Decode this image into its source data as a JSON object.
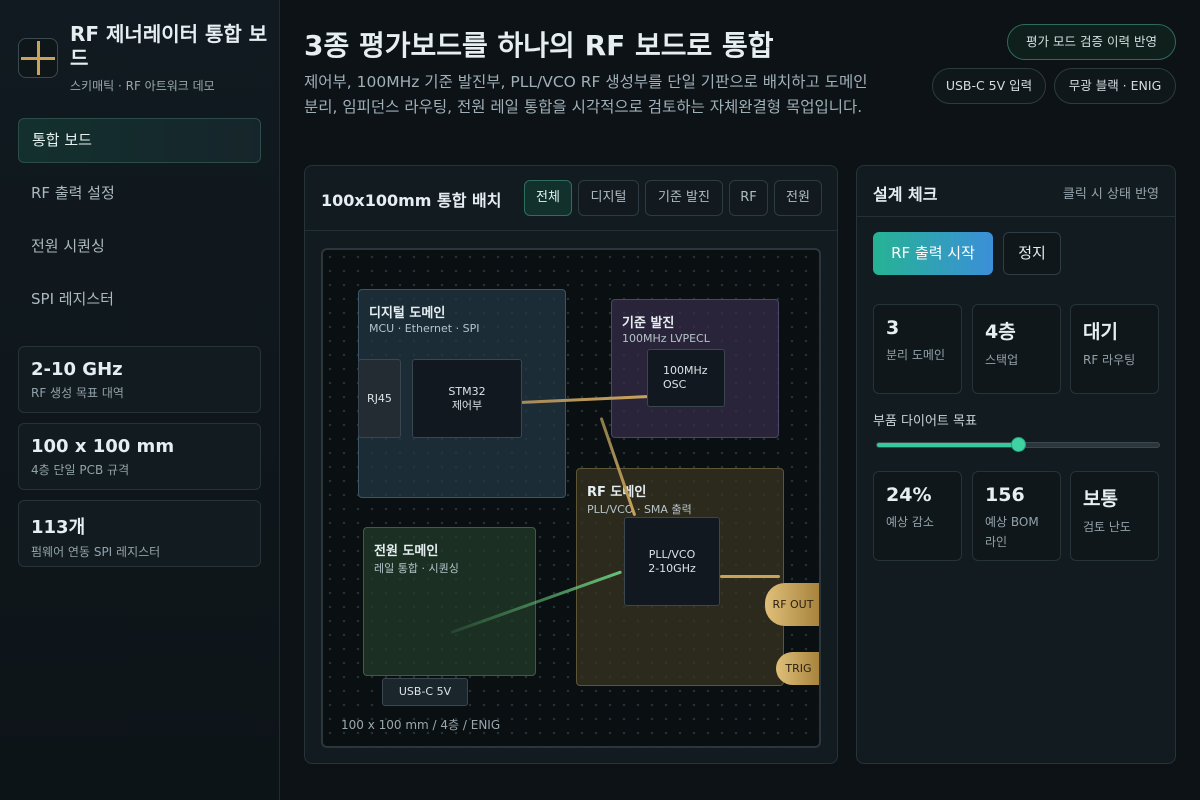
{
  "brand": {
    "title": "RF 제너레이터 통합 보드",
    "subtitle": "스키매틱 · RF 아트워크 데모"
  },
  "nav": [
    {
      "label": "통합 보드",
      "active": true
    },
    {
      "label": "RF 출력 설정",
      "active": false
    },
    {
      "label": "전원 시퀀싱",
      "active": false
    },
    {
      "label": "SPI 레지스터",
      "active": false
    }
  ],
  "stats": [
    {
      "value": "2-10 GHz",
      "label": "RF 생성 목표 대역"
    },
    {
      "value": "100 x 100 mm",
      "label": "4층 단일 PCB 규격"
    },
    {
      "value": "113개",
      "label": "펌웨어 연동 SPI 레지스터"
    }
  ],
  "header": {
    "title": "3종 평가보드를 하나의 RF 보드로 통합",
    "description": "제어부, 100MHz 기준 발진부, PLL/VCO RF 생성부를 단일 기판으로 배치하고 도메인 분리, 임피던스 라우팅, 전원 레일 통합을 시각적으로 검토하는 자체완결형 목업입니다."
  },
  "pills": {
    "history": "평가 모드 검증 이력 반영",
    "usb": "USB-C 5V 입력",
    "finish": "무광 블랙 · ENIG"
  },
  "board": {
    "title": "100x100mm 통합 배치",
    "tabs": [
      "전체",
      "디지털",
      "기준 발진",
      "RF",
      "전원"
    ],
    "active_tab": "전체",
    "domains": {
      "digital": {
        "title": "디지털 도메인",
        "sub": "MCU · Ethernet · SPI"
      },
      "ref": {
        "title": "기준 발진",
        "sub": "100MHz LVPECL"
      },
      "rf": {
        "title": "RF 도메인",
        "sub": "PLL/VCO · SMA 출력"
      },
      "power": {
        "title": "전원 도메인",
        "sub": "레일 통합 · 시퀀싱"
      }
    },
    "chips": {
      "rj45": "RJ45",
      "mcu_l1": "STM32",
      "mcu_l2": "제어부",
      "osc_l1": "100MHz",
      "osc_l2": "OSC",
      "pll_l1": "PLL/VCO",
      "pll_l2": "2-10GHz",
      "usb": "USB-C 5V"
    },
    "connectors": {
      "rf_out": "RF OUT",
      "trig": "TRIG"
    },
    "footer": "100 x 100 mm / 4층 / ENIG"
  },
  "check": {
    "title": "설계 체크",
    "hint": "클릭 시 상태 반영",
    "start_label": "RF 출력 시작",
    "stop_label": "정지",
    "metrics_top": [
      {
        "value": "3",
        "label": "분리 도메인"
      },
      {
        "value": "4층",
        "label": "스택업"
      },
      {
        "value": "대기",
        "label": "RF 라우팅"
      }
    ],
    "slider_label": "부품 다이어트 목표",
    "slider_value": 0.5,
    "metrics_bottom": [
      {
        "value": "24%",
        "label": "예상 감소"
      },
      {
        "value": "156",
        "label": "예상 BOM 라인"
      },
      {
        "value": "보통",
        "label": "검토 난도"
      }
    ]
  },
  "colors": {
    "accent": "#36c99d",
    "gold": "#c9a35a",
    "digital": "#1a2a33",
    "ref": "#2a2636",
    "rf": "#2c2a1c",
    "power": "#1b2b22"
  }
}
